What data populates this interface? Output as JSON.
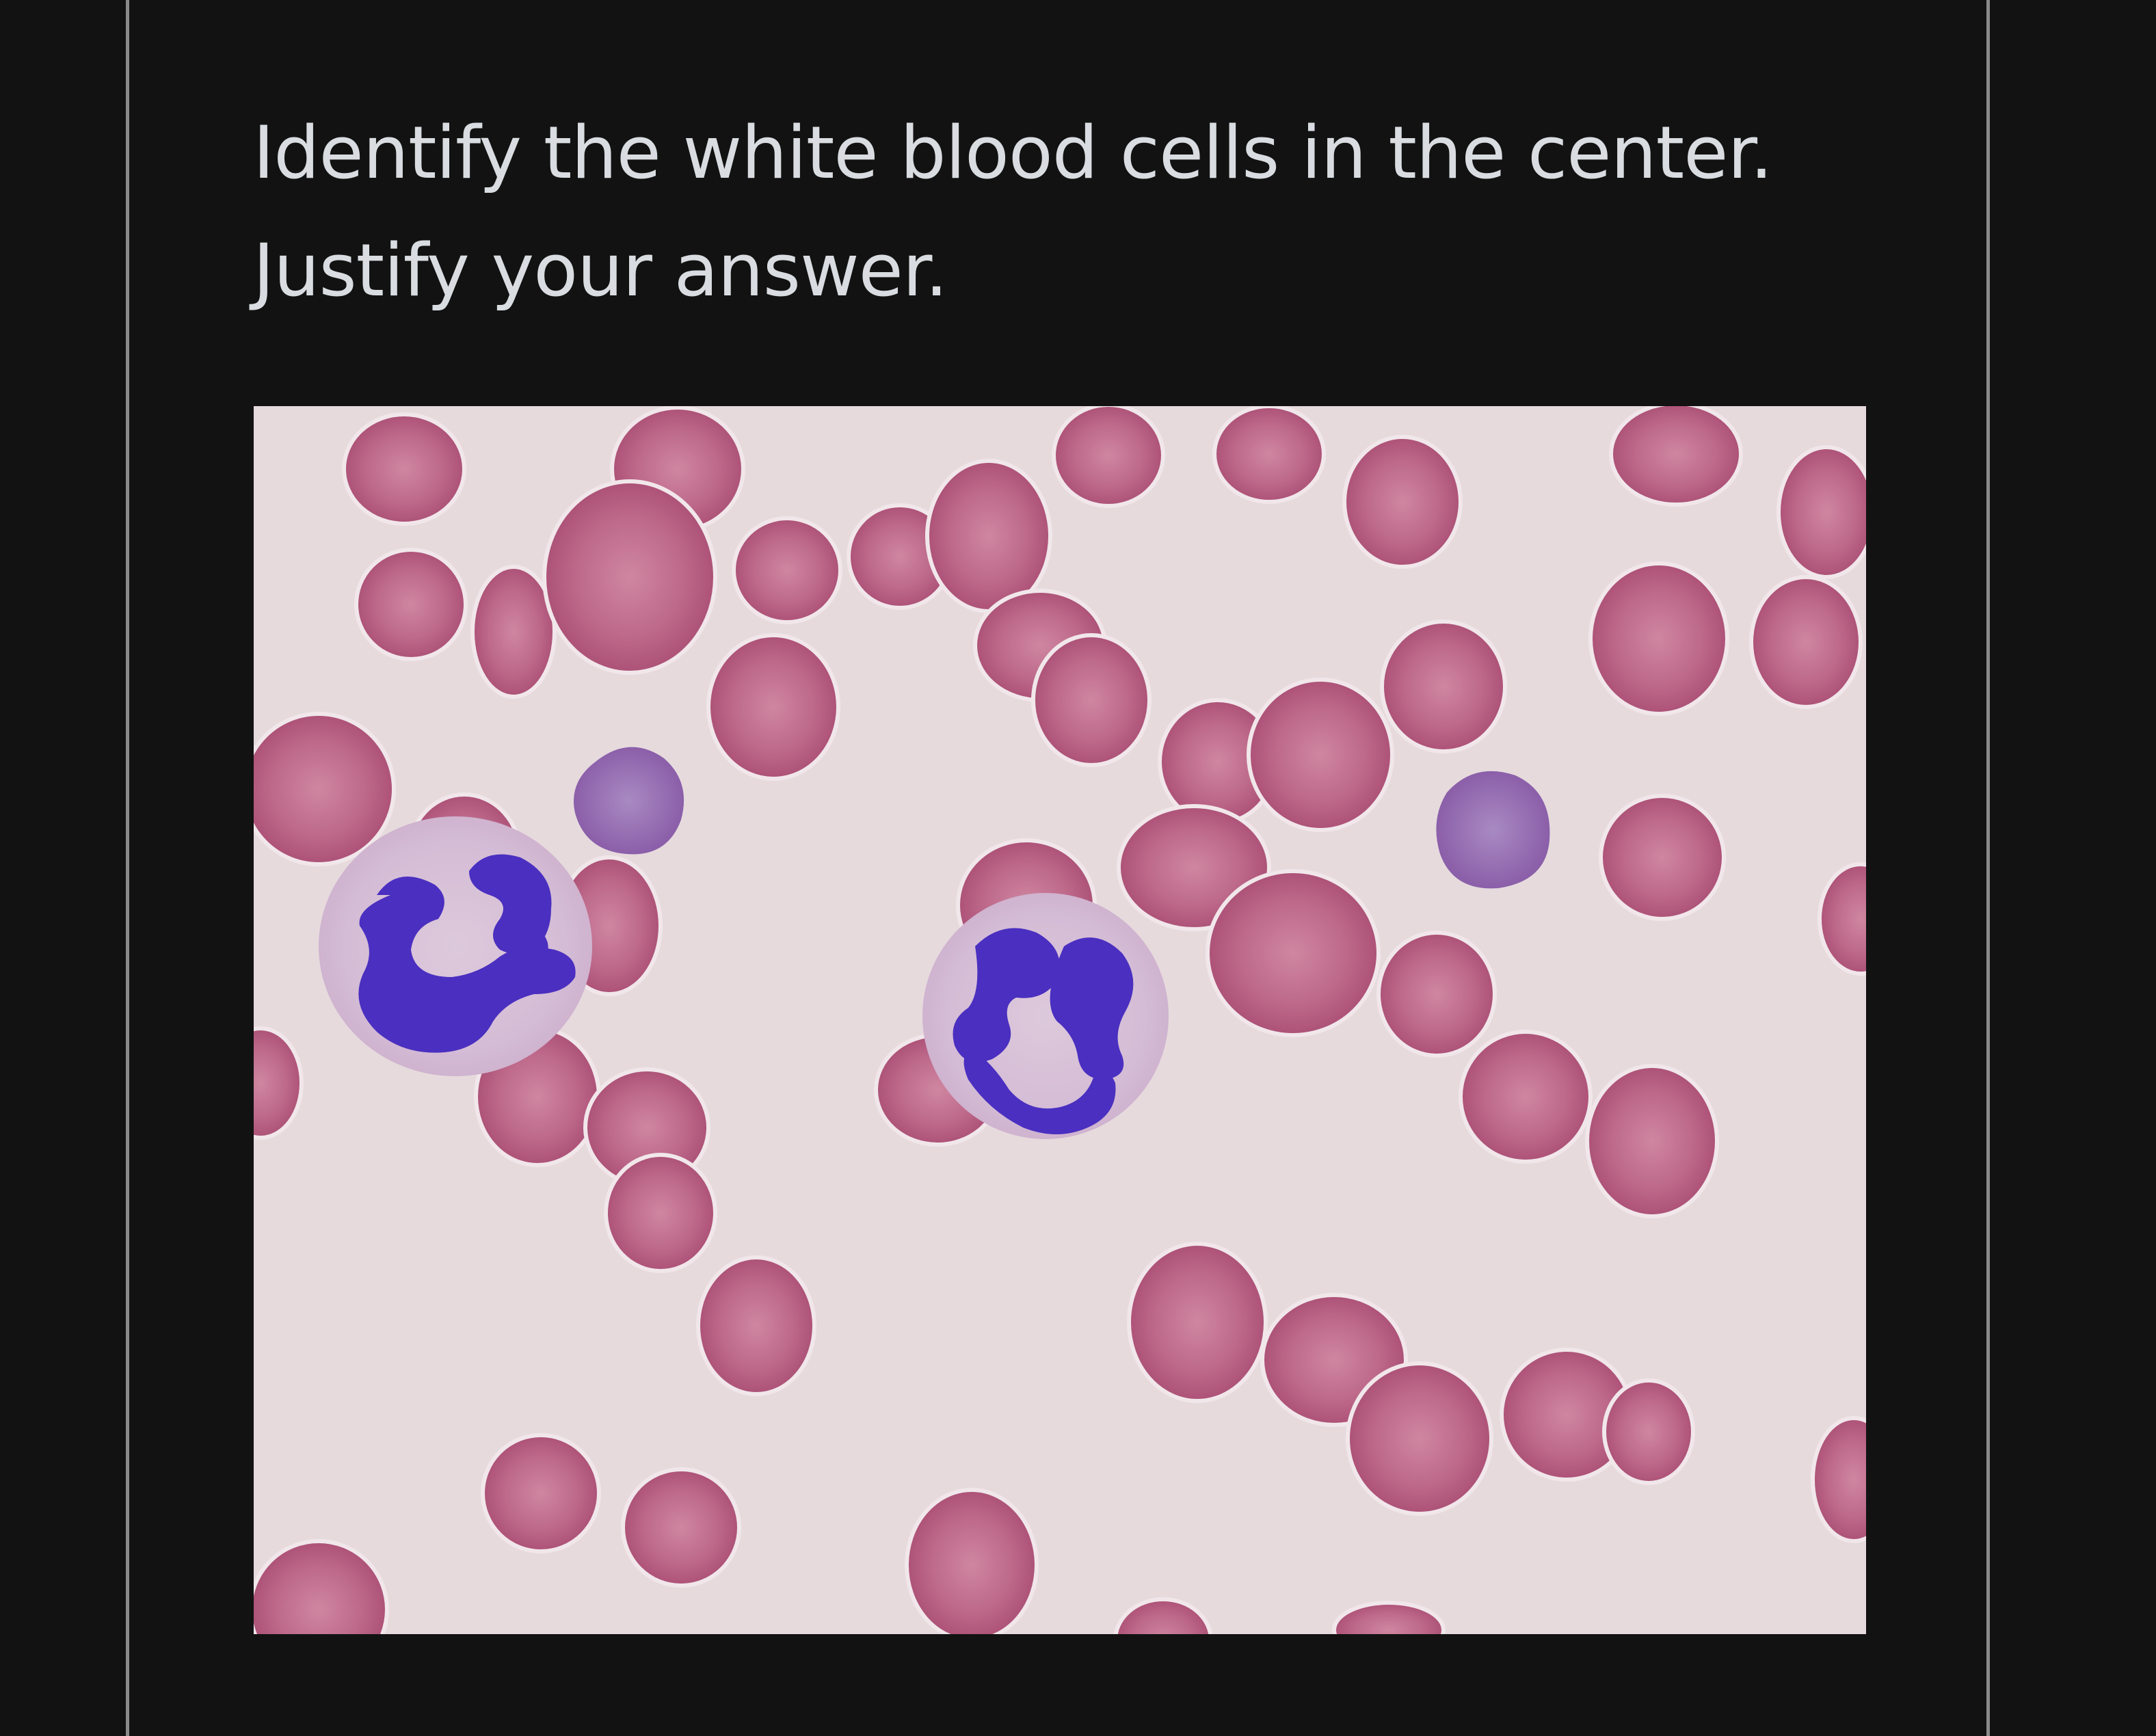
{
  "question": {
    "line1": "Identify the white blood cells in the center.",
    "line2": "Justify your answer."
  },
  "image": {
    "alt": "Blood smear micrograph",
    "colors": {
      "background": "#e5d9dc",
      "rbc": "#b3567a",
      "rbc_center": "#cf86a0",
      "wbc_cytoplasm": "#d2b8d4",
      "wbc_nucleus": "#4a2fc0",
      "platelet": "#9a6bb8"
    }
  }
}
